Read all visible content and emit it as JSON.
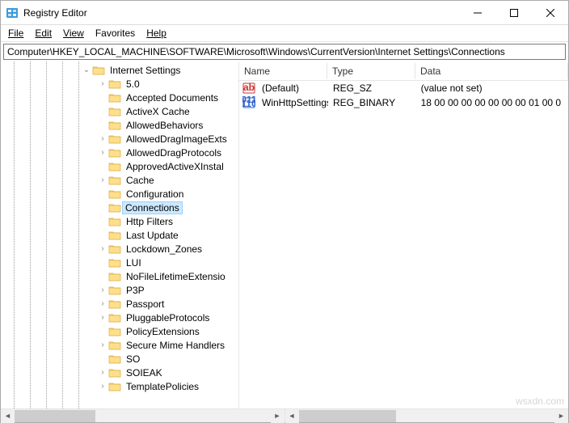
{
  "titlebar": {
    "title": "Registry Editor"
  },
  "menubar": {
    "file": "File",
    "edit": "Edit",
    "view": "View",
    "favorites": "Favorites",
    "help": "Help"
  },
  "addrbar": {
    "path": "Computer\\HKEY_LOCAL_MACHINE\\SOFTWARE\\Microsoft\\Windows\\CurrentVersion\\Internet Settings\\Connections"
  },
  "list": {
    "headers": {
      "name": "Name",
      "type": "Type",
      "data": "Data"
    },
    "rows": [
      {
        "icon": "sz",
        "name": "(Default)",
        "type": "REG_SZ",
        "data": "(value not set)"
      },
      {
        "icon": "bin",
        "name": "WinHttpSettings",
        "type": "REG_BINARY",
        "data": "18 00 00 00 00 00 00 00 01 00 0"
      }
    ]
  },
  "tree": {
    "parent": "Internet Settings",
    "children": [
      "5.0",
      "Accepted Documents",
      "ActiveX Cache",
      "AllowedBehaviors",
      "AllowedDragImageExts",
      "AllowedDragProtocols",
      "ApprovedActiveXInstal",
      "Cache",
      "Configuration",
      "Connections",
      "Http Filters",
      "Last Update",
      "Lockdown_Zones",
      "LUI",
      "NoFileLifetimeExtensio",
      "P3P",
      "Passport",
      "PluggableProtocols",
      "PolicyExtensions",
      "Secure Mime Handlers",
      "SO",
      "SOIEAK",
      "TemplatePolicies"
    ],
    "expandable": [
      "5.0",
      "AllowedDragImageExts",
      "AllowedDragProtocols",
      "Cache",
      "Lockdown_Zones",
      "P3P",
      "Passport",
      "PluggableProtocols",
      "Secure Mime Handlers",
      "SOIEAK",
      "TemplatePolicies"
    ],
    "selected": "Connections"
  },
  "watermark": "wsxdn.com"
}
